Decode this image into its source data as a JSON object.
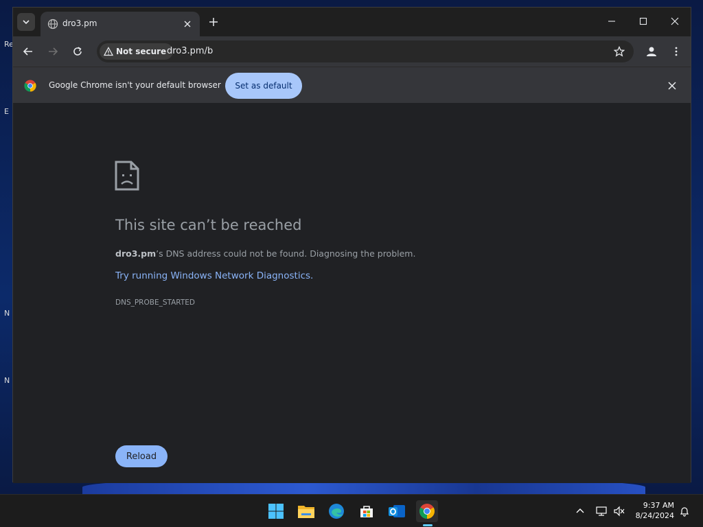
{
  "tab": {
    "title": "dro3.pm"
  },
  "omnibox": {
    "security_label": "Not secure",
    "url": "dro3.pm/b"
  },
  "infobar": {
    "message": "Google Chrome isn't your default browser",
    "button_label": "Set as default"
  },
  "error": {
    "title": "This site can’t be reached",
    "domain": "dro3.pm",
    "description_rest": "’s DNS address could not be found. Diagnosing the problem.",
    "link": "Try running Windows Network Diagnostics.",
    "code": "DNS_PROBE_STARTED",
    "reload_label": "Reload"
  },
  "taskbar": {
    "apps": [
      "start-icon",
      "file-explorer-icon",
      "edge-icon",
      "store-icon",
      "outlook-icon",
      "chrome-icon"
    ],
    "time": "9:37 AM",
    "date": "8/24/2024"
  },
  "desktop_glyphs": [
    "Re",
    "E",
    "N",
    "N"
  ],
  "colors": {
    "link": "#8ab4f8",
    "button": "#a8c7fa",
    "accent": "#60cdff"
  }
}
